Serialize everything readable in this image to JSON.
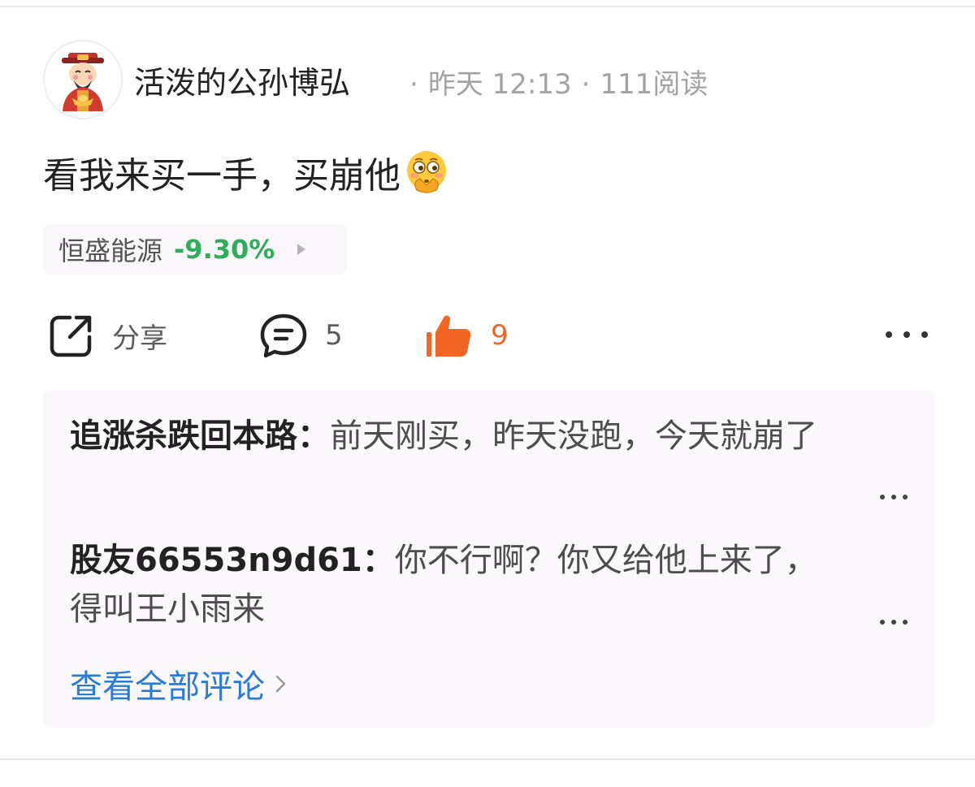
{
  "post": {
    "author": "活泼的公孙博弘",
    "time": "昨天 12:13",
    "reads": "111阅读",
    "text": "看我来买一手，买崩他",
    "emoji": "flushed-hands-emoji"
  },
  "stock": {
    "name": "恒盛能源",
    "change": "-9.30%",
    "change_color": "#2eae5a"
  },
  "actions": {
    "share_label": "分享",
    "comment_count": "5",
    "like_count": "9",
    "like_color": "#f26522",
    "icons": [
      "share-icon",
      "comment-icon",
      "thumbs-up-icon",
      "more-icon"
    ]
  },
  "comments": [
    {
      "user": "追涨杀跌回本路",
      "separator": "：",
      "text": "前天刚买，昨天没跑，今天就崩了"
    },
    {
      "user": "股友66553n9d61",
      "separator": "：",
      "text": "你不行啊？你又给他上来了，得叫王小雨来"
    }
  ],
  "view_all": {
    "label": "查看全部评论",
    "color": "#2a7bd6"
  }
}
